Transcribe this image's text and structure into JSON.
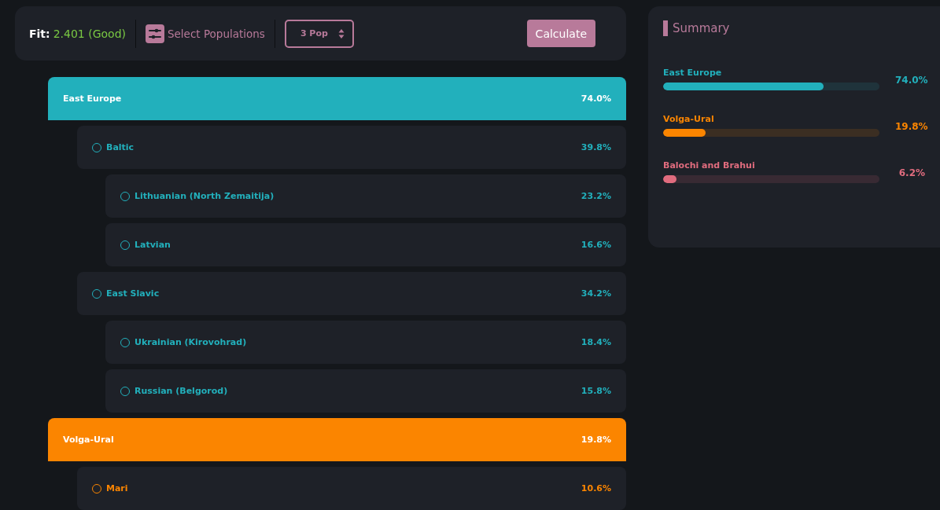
{
  "toolbar": {
    "fit_label": "Fit:",
    "fit_value": "2.401 (Good)",
    "select_label": "Select Populations",
    "pop_select": "3 Pop",
    "calculate": "Calculate"
  },
  "tree": [
    {
      "name": "East Europe",
      "value": "74.0%",
      "color": "#22b0bc",
      "children": [
        {
          "name": "Baltic",
          "value": "39.8%",
          "children": [
            {
              "name": "Lithuanian (North Zemaitija)",
              "value": "23.2%"
            },
            {
              "name": "Latvian",
              "value": "16.6%"
            }
          ]
        },
        {
          "name": "East Slavic",
          "value": "34.2%",
          "children": [
            {
              "name": "Ukrainian (Kirovohrad)",
              "value": "18.4%"
            },
            {
              "name": "Russian (Belgorod)",
              "value": "15.8%"
            }
          ]
        }
      ]
    },
    {
      "name": "Volga-Ural",
      "value": "19.8%",
      "color": "#fb8500",
      "children": [
        {
          "name": "Mari",
          "value": "10.6%"
        }
      ]
    }
  ],
  "summary": {
    "title": "Summary",
    "items": [
      {
        "name": "East Europe",
        "value": "74.0%",
        "level": 0.74,
        "color": "#22b0bc"
      },
      {
        "name": "Volga-Ural",
        "value": "19.8%",
        "level": 0.198,
        "color": "#fb8500"
      },
      {
        "name": "Balochi and Brahui",
        "value": "6.2%",
        "level": 0.062,
        "color": "#e06c7e"
      }
    ]
  }
}
